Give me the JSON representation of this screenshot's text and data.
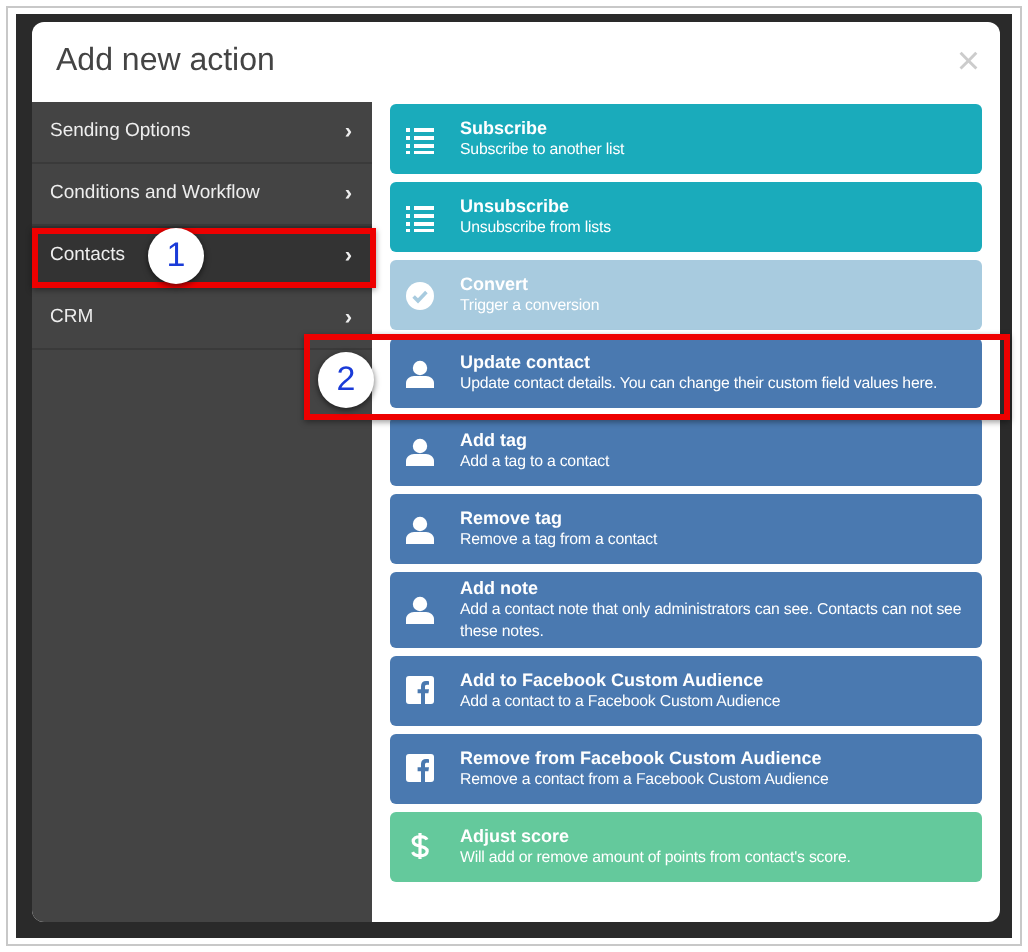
{
  "modal": {
    "title": "Add new action",
    "close": "×"
  },
  "sidebar": {
    "items": [
      {
        "label": "Sending Options",
        "chevron": "›",
        "selected": false
      },
      {
        "label": "Conditions and Workflow",
        "chevron": "›",
        "selected": false
      },
      {
        "label": "Contacts",
        "chevron": "›",
        "selected": true
      },
      {
        "label": "CRM",
        "chevron": "›",
        "selected": false
      }
    ]
  },
  "actions": [
    {
      "kind": "list",
      "color": "#1aabbb",
      "title": "Subscribe",
      "description": "Subscribe to another list"
    },
    {
      "kind": "list",
      "color": "#1aabbb",
      "title": "Unsubscribe",
      "description": "Unsubscribe from lists"
    },
    {
      "kind": "check",
      "color": "#a8cbdf",
      "title": "Convert",
      "description": "Trigger a conversion"
    },
    {
      "kind": "person",
      "color": "#4a79b0",
      "title": "Update contact",
      "description": "Update contact details. You can change their custom field values here."
    },
    {
      "kind": "person",
      "color": "#4a79b0",
      "title": "Add tag",
      "description": "Add a tag to a contact"
    },
    {
      "kind": "person",
      "color": "#4a79b0",
      "title": "Remove tag",
      "description": "Remove a tag from a contact"
    },
    {
      "kind": "person",
      "color": "#4a79b0",
      "title": "Add note",
      "description": "Add a contact note that only administrators can see. Contacts can not see these notes."
    },
    {
      "kind": "facebook",
      "color": "#4a79b0",
      "title": "Add to Facebook Custom Audience",
      "description": "Add a contact to a Facebook Custom Audience"
    },
    {
      "kind": "facebook",
      "color": "#4a79b0",
      "title": "Remove from Facebook Custom Audience",
      "description": "Remove a contact from a Facebook Custom Audience"
    },
    {
      "kind": "dollar",
      "color": "#64c99c",
      "title": "Adjust score",
      "description": "Will add or remove amount of points from contact's score."
    }
  ],
  "callouts": [
    {
      "number": "1"
    },
    {
      "number": "2"
    }
  ]
}
